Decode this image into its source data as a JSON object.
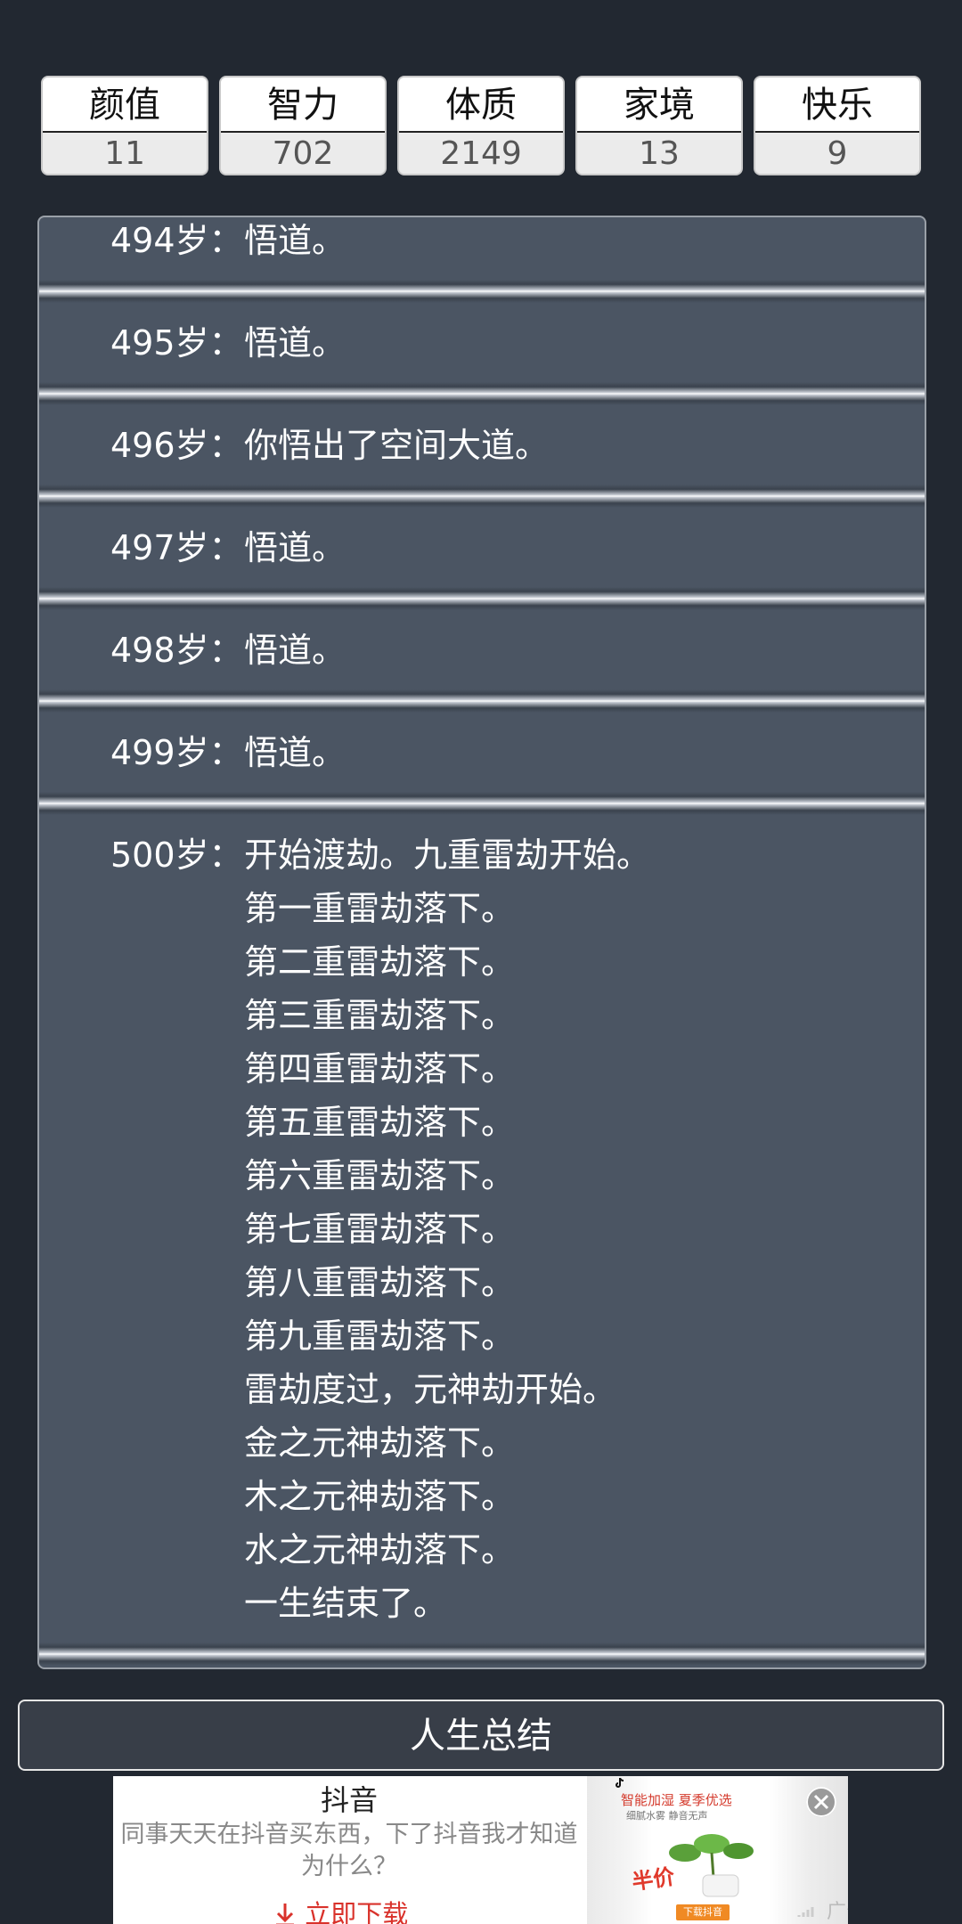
{
  "stats": [
    {
      "label": "颜值",
      "value": "11"
    },
    {
      "label": "智力",
      "value": "702"
    },
    {
      "label": "体质",
      "value": "2149"
    },
    {
      "label": "家境",
      "value": "13"
    },
    {
      "label": "快乐",
      "value": "9"
    }
  ],
  "log": [
    {
      "age": "494岁：",
      "events": [
        "悟道。"
      ]
    },
    {
      "age": "495岁：",
      "events": [
        "悟道。"
      ]
    },
    {
      "age": "496岁：",
      "events": [
        "你悟出了空间大道。"
      ]
    },
    {
      "age": "497岁：",
      "events": [
        "悟道。"
      ]
    },
    {
      "age": "498岁：",
      "events": [
        "悟道。"
      ]
    },
    {
      "age": "499岁：",
      "events": [
        "悟道。"
      ]
    },
    {
      "age": "500岁：",
      "events": [
        "开始渡劫。九重雷劫开始。",
        "第一重雷劫落下。",
        "第二重雷劫落下。",
        "第三重雷劫落下。",
        "第四重雷劫落下。",
        "第五重雷劫落下。",
        "第六重雷劫落下。",
        "第七重雷劫落下。",
        "第八重雷劫落下。",
        "第九重雷劫落下。",
        "雷劫度过，元神劫开始。",
        "金之元神劫落下。",
        "木之元神劫落下。",
        "水之元神劫落下。",
        "一生结束了。"
      ]
    }
  ],
  "summary_button": "人生总结",
  "ad": {
    "title": "抖音",
    "description": "同事天天在抖音买东西，下了抖音我才知道为什么？",
    "download_label": "立即下载",
    "image_headline": "智能加湿 夏季优选",
    "image_subline": "细腻水雾 静音无声",
    "image_badge": "半价",
    "image_button": "下载抖音",
    "ad_label": "广告"
  }
}
